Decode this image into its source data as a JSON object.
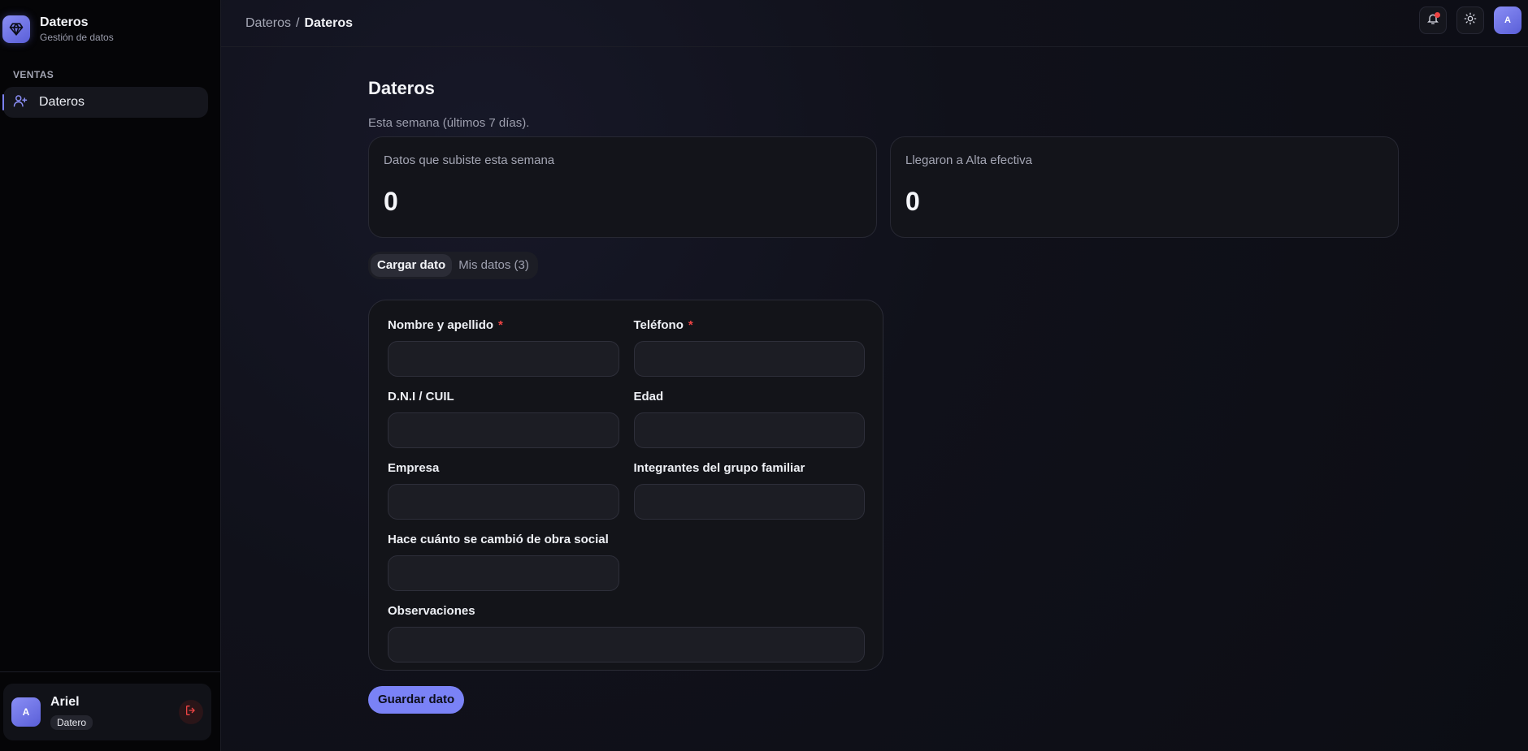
{
  "brand": {
    "name": "Dateros",
    "subtitle": "Gestión de datos",
    "icon": "gem-icon"
  },
  "sidebar": {
    "section": "VENTAS",
    "items": [
      {
        "label": "Dateros",
        "icon": "user-plus-icon",
        "active": true
      }
    ]
  },
  "user": {
    "initial": "A",
    "name": "Ariel",
    "role": "Datero"
  },
  "topbar": {
    "breadcrumb": [
      "Dateros",
      "Dateros"
    ],
    "avatar_initial": "A"
  },
  "page": {
    "title": "Dateros",
    "subtitle": "Esta semana (últimos 7 días).",
    "stats": [
      {
        "label": "Datos que subiste esta semana",
        "value": "0"
      },
      {
        "label": "Llegaron a Alta efectiva",
        "value": "0"
      }
    ],
    "tabs": [
      {
        "label": "Cargar dato",
        "active": true
      },
      {
        "label": "Mis datos (3)",
        "active": false
      }
    ]
  },
  "form": {
    "fields": {
      "nombre": {
        "label": "Nombre y apellido",
        "required": "*",
        "value": ""
      },
      "telefono": {
        "label": "Teléfono",
        "required": "*",
        "value": ""
      },
      "dni": {
        "label": "D.N.I / CUIL",
        "value": ""
      },
      "edad": {
        "label": "Edad",
        "value": ""
      },
      "empresa": {
        "label": "Empresa",
        "value": ""
      },
      "integrantes": {
        "label": "Integrantes del grupo familiar",
        "value": ""
      },
      "cambio": {
        "label": "Hace cuánto se cambió de obra social",
        "value": ""
      },
      "observaciones": {
        "label": "Observaciones",
        "value": ""
      }
    },
    "submit_label": "Guardar dato"
  },
  "colors": {
    "accent": "#7a82f6",
    "required": "#ef4444",
    "background": "#0b0c13"
  }
}
